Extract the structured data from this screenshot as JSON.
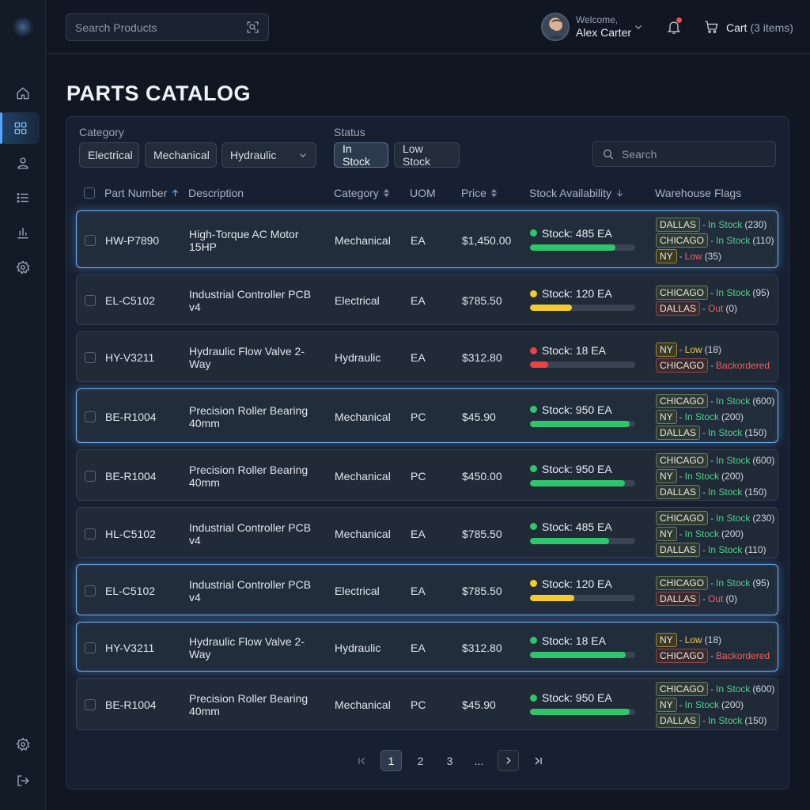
{
  "header": {
    "search_placeholder": "Search Products",
    "welcome_label": "Welcome,",
    "user_name": "Alex Carter",
    "cart_label": "Cart",
    "cart_count": "(3 items)"
  },
  "page": {
    "title": "PARTS CATALOG"
  },
  "filters": {
    "category_label": "Category",
    "category_chips": [
      "Electrical",
      "Mechanical"
    ],
    "category_dropdown": "Hydraulic",
    "status_label": "Status",
    "status_chips": [
      "In Stock",
      "Low Stock"
    ],
    "search_placeholder": "Search"
  },
  "table": {
    "columns": {
      "part_number": "Part Number",
      "description": "Description",
      "category": "Category",
      "uom": "UOM",
      "price": "Price",
      "stock": "Stock Availability",
      "flags": "Warehouse Flags"
    },
    "rows": [
      {
        "part": "HW-P7890",
        "desc": "High-Torque AC Motor 15HP",
        "category": "Mechanical",
        "uom": "EA",
        "price": "$1,450.00",
        "stock_text": "Stock: 485 EA",
        "stock_level": 0.81,
        "stock_color": "#2fc56d",
        "flags": [
          {
            "wh": "DALLAS",
            "status": "In Stock",
            "count": "(230)",
            "kind": "ok"
          },
          {
            "wh": "CHICAGO",
            "status": "In Stock",
            "count": "(110)",
            "kind": "ok"
          },
          {
            "wh": "NY",
            "status": "Low",
            "count": "(35)",
            "kind": "lowred"
          }
        ]
      },
      {
        "part": "EL-C5102",
        "desc": "Industrial Controller PCB v4",
        "category": "Electrical",
        "uom": "EA",
        "price": "$785.50",
        "stock_text": "Stock: 120 EA",
        "stock_level": 0.4,
        "stock_color": "#f2cc2e",
        "flags": [
          {
            "wh": "CHICAGO",
            "status": "In Stock",
            "count": "(95)",
            "kind": "ok"
          },
          {
            "wh": "DALLAS",
            "status": "Out",
            "count": "(0)",
            "kind": "out"
          }
        ]
      },
      {
        "part": "HY-V3211",
        "desc": "Hydraulic Flow Valve 2-Way",
        "category": "Hydraulic",
        "uom": "EA",
        "price": "$312.80",
        "stock_text": "Stock: 18 EA",
        "stock_level": 0.17,
        "stock_color": "#ea4545",
        "flags": [
          {
            "wh": "NY",
            "status": "Low",
            "count": "(18)",
            "kind": "low"
          },
          {
            "wh": "CHICAGO",
            "status": "Backordered",
            "count": "",
            "kind": "out"
          }
        ]
      },
      {
        "part": "BE-R1004",
        "desc": "Precision Roller Bearing 40mm",
        "category": "Mechanical",
        "uom": "PC",
        "price": "$45.90",
        "stock_text": "Stock: 950 EA",
        "stock_level": 0.95,
        "stock_color": "#2fc56d",
        "flags": [
          {
            "wh": "CHICAGO",
            "status": "In Stock",
            "count": "(600)",
            "kind": "ok"
          },
          {
            "wh": "NY",
            "status": "In Stock",
            "count": "(200)",
            "kind": "ok"
          },
          {
            "wh": "DALLAS",
            "status": "In Stock",
            "count": "(150)",
            "kind": "ok"
          }
        ]
      },
      {
        "part": "BE-R1004",
        "desc": "Precision Roller Bearing 40mm",
        "category": "Mechanical",
        "uom": "PC",
        "price": "$450.00",
        "stock_text": "Stock: 950 EA",
        "stock_level": 0.9,
        "stock_color": "#2fc56d",
        "flags": [
          {
            "wh": "CHICAGO",
            "status": "In Stock",
            "count": "(600)",
            "kind": "ok"
          },
          {
            "wh": "NY",
            "status": "In Stock",
            "count": "(200)",
            "kind": "ok"
          },
          {
            "wh": "DALLAS",
            "status": "In Stock",
            "count": "(150)",
            "kind": "ok"
          }
        ]
      },
      {
        "part": "HL-C5102",
        "desc": "Industrial Controller PCB v4",
        "category": "Mechanical",
        "uom": "EA",
        "price": "$785.50",
        "stock_text": "Stock: 485 EA",
        "stock_level": 0.75,
        "stock_color": "#2fc56d",
        "flags": [
          {
            "wh": "CHICAGO",
            "status": "In Stock",
            "count": "(230)",
            "kind": "ok"
          },
          {
            "wh": "NY",
            "status": "In Stock",
            "count": "(200)",
            "kind": "ok"
          },
          {
            "wh": "DALLAS",
            "status": "In Stock",
            "count": "(110)",
            "kind": "ok"
          }
        ]
      },
      {
        "part": "EL-C5102",
        "desc": "Industrial Controller PCB v4",
        "category": "Electrical",
        "uom": "EA",
        "price": "$785.50",
        "stock_text": "Stock: 120 EA",
        "stock_level": 0.42,
        "stock_color": "#f2cc2e",
        "flags": [
          {
            "wh": "CHICAGO",
            "status": "In Stock",
            "count": "(95)",
            "kind": "ok"
          },
          {
            "wh": "DALLAS",
            "status": "Out",
            "count": "(0)",
            "kind": "out"
          }
        ]
      },
      {
        "part": "HY-V3211",
        "desc": "Hydraulic Flow Valve 2-Way",
        "category": "Hydraulic",
        "uom": "EA",
        "price": "$312.80",
        "stock_text": "Stock: 18 EA",
        "stock_level": 0.91,
        "stock_color": "#2fc56d",
        "flags": [
          {
            "wh": "NY",
            "status": "Low",
            "count": "(18)",
            "kind": "low"
          },
          {
            "wh": "CHICAGO",
            "status": "Backordered",
            "count": "",
            "kind": "out"
          }
        ]
      },
      {
        "part": "BE-R1004",
        "desc": "Precision Roller Bearing 40mm",
        "category": "Mechanical",
        "uom": "PC",
        "price": "$45.90",
        "stock_text": "Stock: 950 EA",
        "stock_level": 0.95,
        "stock_color": "#2fc56d",
        "flags": [
          {
            "wh": "CHICAGO",
            "status": "In Stock",
            "count": "(600)",
            "kind": "ok"
          },
          {
            "wh": "NY",
            "status": "In Stock",
            "count": "(200)",
            "kind": "ok"
          },
          {
            "wh": "DALLAS",
            "status": "In Stock",
            "count": "(150)",
            "kind": "ok"
          }
        ]
      }
    ]
  },
  "pagination": {
    "pages": [
      "1",
      "2",
      "3"
    ],
    "ellipsis": "...",
    "current": "1"
  },
  "sidebar": {
    "icons": [
      "home-icon",
      "grid-icon",
      "user-icon",
      "list-icon",
      "chart-icon",
      "settings-icon"
    ],
    "bottom_icons": [
      "settings-icon",
      "logout-icon"
    ]
  }
}
